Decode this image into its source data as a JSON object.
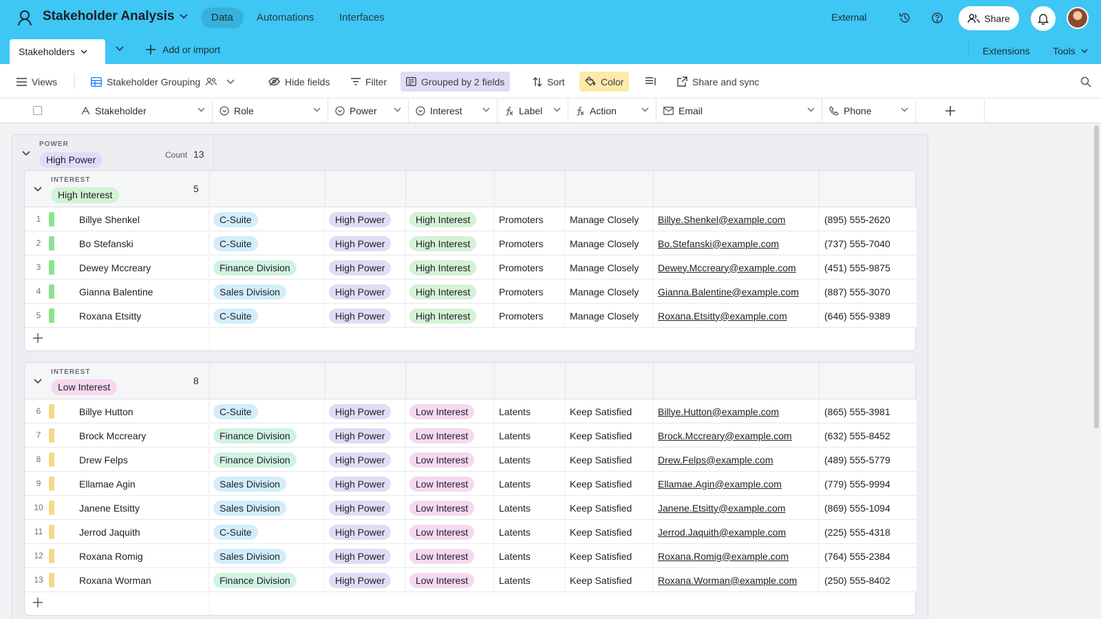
{
  "app": {
    "base_title": "Stakeholder Analysis",
    "tabs": [
      "Data",
      "Automations",
      "Interfaces"
    ],
    "active_tab": "Data",
    "external_label": "External",
    "share_label": "Share"
  },
  "tabbar": {
    "table_name": "Stakeholders",
    "add_import": "Add or import",
    "extensions": "Extensions",
    "tools": "Tools"
  },
  "viewbar": {
    "views": "Views",
    "view_name": "Stakeholder Grouping",
    "hide_fields": "Hide fields",
    "filter": "Filter",
    "grouped": "Grouped by 2 fields",
    "sort": "Sort",
    "color": "Color",
    "share_sync": "Share and sync"
  },
  "columns": [
    "Stakeholder",
    "Role",
    "Power",
    "Interest",
    "Label",
    "Action",
    "Email",
    "Phone"
  ],
  "colors": {
    "accent": "#3ec6f5",
    "high_power_pill": "#e2dbf7",
    "high_interest_pill": "#d3f2d6",
    "low_interest_pill": "#f7d9ef",
    "role_csuite": "#d2eefb",
    "role_finance": "#d1f3e2",
    "role_sales": "#d2eefb",
    "bar_green": "#8ee28f",
    "bar_yellow": "#f8d98a"
  },
  "outer_group": {
    "field": "POWER",
    "value": "High Power",
    "count_label": "Count",
    "count": "13"
  },
  "groups": [
    {
      "field": "INTEREST",
      "value": "High Interest",
      "count": "5",
      "bar": "green",
      "rows": [
        {
          "n": "1",
          "name": "Billye Shenkel",
          "role": "C-Suite",
          "power": "High Power",
          "interest": "High Interest",
          "label": "Promoters",
          "action": "Manage Closely",
          "email": "Billye.Shenkel@example.com",
          "phone": "(895) 555-2620"
        },
        {
          "n": "2",
          "name": "Bo Stefanski",
          "role": "C-Suite",
          "power": "High Power",
          "interest": "High Interest",
          "label": "Promoters",
          "action": "Manage Closely",
          "email": "Bo.Stefanski@example.com",
          "phone": "(737) 555-7040"
        },
        {
          "n": "3",
          "name": "Dewey Mccreary",
          "role": "Finance Division",
          "power": "High Power",
          "interest": "High Interest",
          "label": "Promoters",
          "action": "Manage Closely",
          "email": "Dewey.Mccreary@example.com",
          "phone": "(451) 555-9875"
        },
        {
          "n": "4",
          "name": "Gianna Balentine",
          "role": "Sales Division",
          "power": "High Power",
          "interest": "High Interest",
          "label": "Promoters",
          "action": "Manage Closely",
          "email": "Gianna.Balentine@example.com",
          "phone": "(887) 555-3070"
        },
        {
          "n": "5",
          "name": "Roxana Etsitty",
          "role": "C-Suite",
          "power": "High Power",
          "interest": "High Interest",
          "label": "Promoters",
          "action": "Manage Closely",
          "email": "Roxana.Etsitty@example.com",
          "phone": "(646) 555-9389"
        }
      ]
    },
    {
      "field": "INTEREST",
      "value": "Low Interest",
      "count": "8",
      "bar": "yellow",
      "rows": [
        {
          "n": "6",
          "name": "Billye Hutton",
          "role": "C-Suite",
          "power": "High Power",
          "interest": "Low Interest",
          "label": "Latents",
          "action": "Keep Satisfied",
          "email": "Billye.Hutton@example.com",
          "phone": "(865) 555-3981"
        },
        {
          "n": "7",
          "name": "Brock Mccreary",
          "role": "Finance Division",
          "power": "High Power",
          "interest": "Low Interest",
          "label": "Latents",
          "action": "Keep Satisfied",
          "email": "Brock.Mccreary@example.com",
          "phone": "(632) 555-8452"
        },
        {
          "n": "8",
          "name": "Drew Felps",
          "role": "Finance Division",
          "power": "High Power",
          "interest": "Low Interest",
          "label": "Latents",
          "action": "Keep Satisfied",
          "email": "Drew.Felps@example.com",
          "phone": "(489) 555-5779"
        },
        {
          "n": "9",
          "name": "Ellamae Agin",
          "role": "Sales Division",
          "power": "High Power",
          "interest": "Low Interest",
          "label": "Latents",
          "action": "Keep Satisfied",
          "email": "Ellamae.Agin@example.com",
          "phone": "(779) 555-9994"
        },
        {
          "n": "10",
          "name": "Janene Etsitty",
          "role": "Sales Division",
          "power": "High Power",
          "interest": "Low Interest",
          "label": "Latents",
          "action": "Keep Satisfied",
          "email": "Janene.Etsitty@example.com",
          "phone": "(869) 555-1094"
        },
        {
          "n": "11",
          "name": "Jerrod Jaquith",
          "role": "C-Suite",
          "power": "High Power",
          "interest": "Low Interest",
          "label": "Latents",
          "action": "Keep Satisfied",
          "email": "Jerrod.Jaquith@example.com",
          "phone": "(225) 555-4318"
        },
        {
          "n": "12",
          "name": "Roxana Romig",
          "role": "Sales Division",
          "power": "High Power",
          "interest": "Low Interest",
          "label": "Latents",
          "action": "Keep Satisfied",
          "email": "Roxana.Romig@example.com",
          "phone": "(764) 555-2384"
        },
        {
          "n": "13",
          "name": "Roxana Worman",
          "role": "Finance Division",
          "power": "High Power",
          "interest": "Low Interest",
          "label": "Latents",
          "action": "Keep Satisfied",
          "email": "Roxana.Worman@example.com",
          "phone": "(250) 555-8402"
        }
      ]
    }
  ]
}
